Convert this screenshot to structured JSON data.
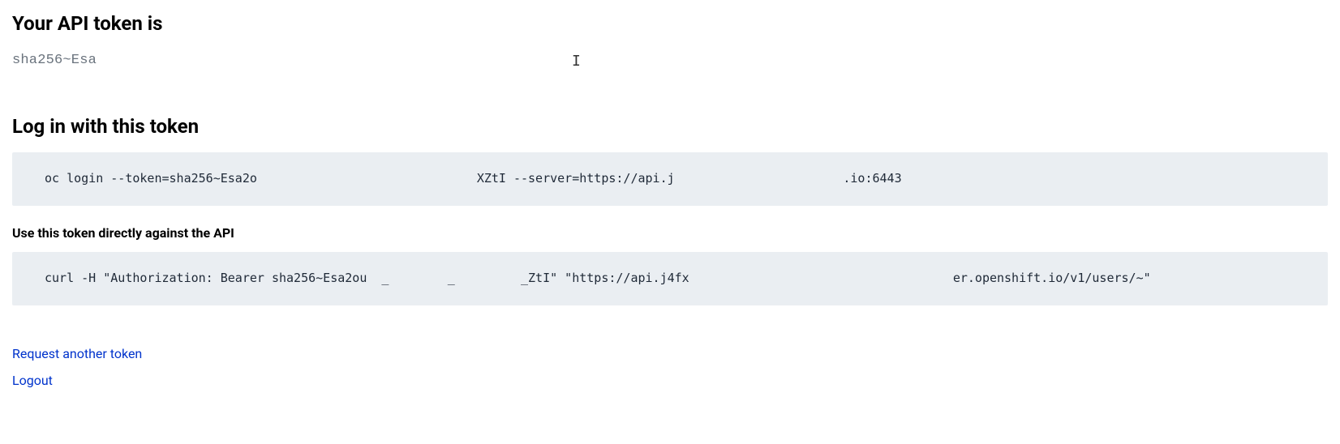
{
  "heading_token": "Your API token is",
  "token_value": "sha256~Esa",
  "heading_login": "Log in with this token",
  "login_command": "oc login --token=sha256~Esa2o                              XZtI --server=https://api.j                       .io:6443",
  "heading_api": "Use this token directly against the API",
  "curl_command": "curl -H \"Authorization: Bearer sha256~Esa2ou  _        _         _ZtI\" \"https://api.j4fx                                    er.openshift.io/v1/users/~\"",
  "request_link": "Request another token",
  "logout_link": "Logout"
}
